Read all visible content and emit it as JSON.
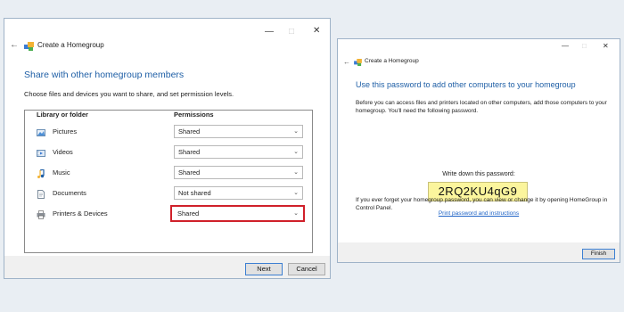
{
  "window1": {
    "title": "Create a Homegroup",
    "heading": "Share with other homegroup members",
    "description": "Choose files and devices you want to share, and set permission levels.",
    "columns": {
      "library": "Library or folder",
      "permissions": "Permissions"
    },
    "rows": [
      {
        "label": "Pictures",
        "permission": "Shared",
        "icon": "pictures-icon"
      },
      {
        "label": "Videos",
        "permission": "Shared",
        "icon": "videos-icon"
      },
      {
        "label": "Music",
        "permission": "Shared",
        "icon": "music-icon"
      },
      {
        "label": "Documents",
        "permission": "Not shared",
        "icon": "documents-icon"
      },
      {
        "label": "Printers & Devices",
        "permission": "Shared",
        "icon": "printer-icon"
      }
    ],
    "buttons": {
      "next": "Next",
      "cancel": "Cancel"
    }
  },
  "window2": {
    "title": "Create a Homegroup",
    "heading": "Use this password to add other computers to your homegroup",
    "description": "Before you can access files and printers located on other computers, add those computers to your homegroup. You'll need the following password.",
    "password_label": "Write down this password:",
    "password": "2RQ2KU4qG9",
    "print_link": "Print password and instructions",
    "forget_text": "If you ever forget your homegroup password, you can view or change it by opening HomeGroup in Control Panel.",
    "buttons": {
      "finish": "Finish"
    }
  },
  "colors": {
    "heading": "#1f5fa6",
    "highlight": "#d0202a",
    "password_bg": "#fbf59d",
    "link": "#1e63c6"
  }
}
